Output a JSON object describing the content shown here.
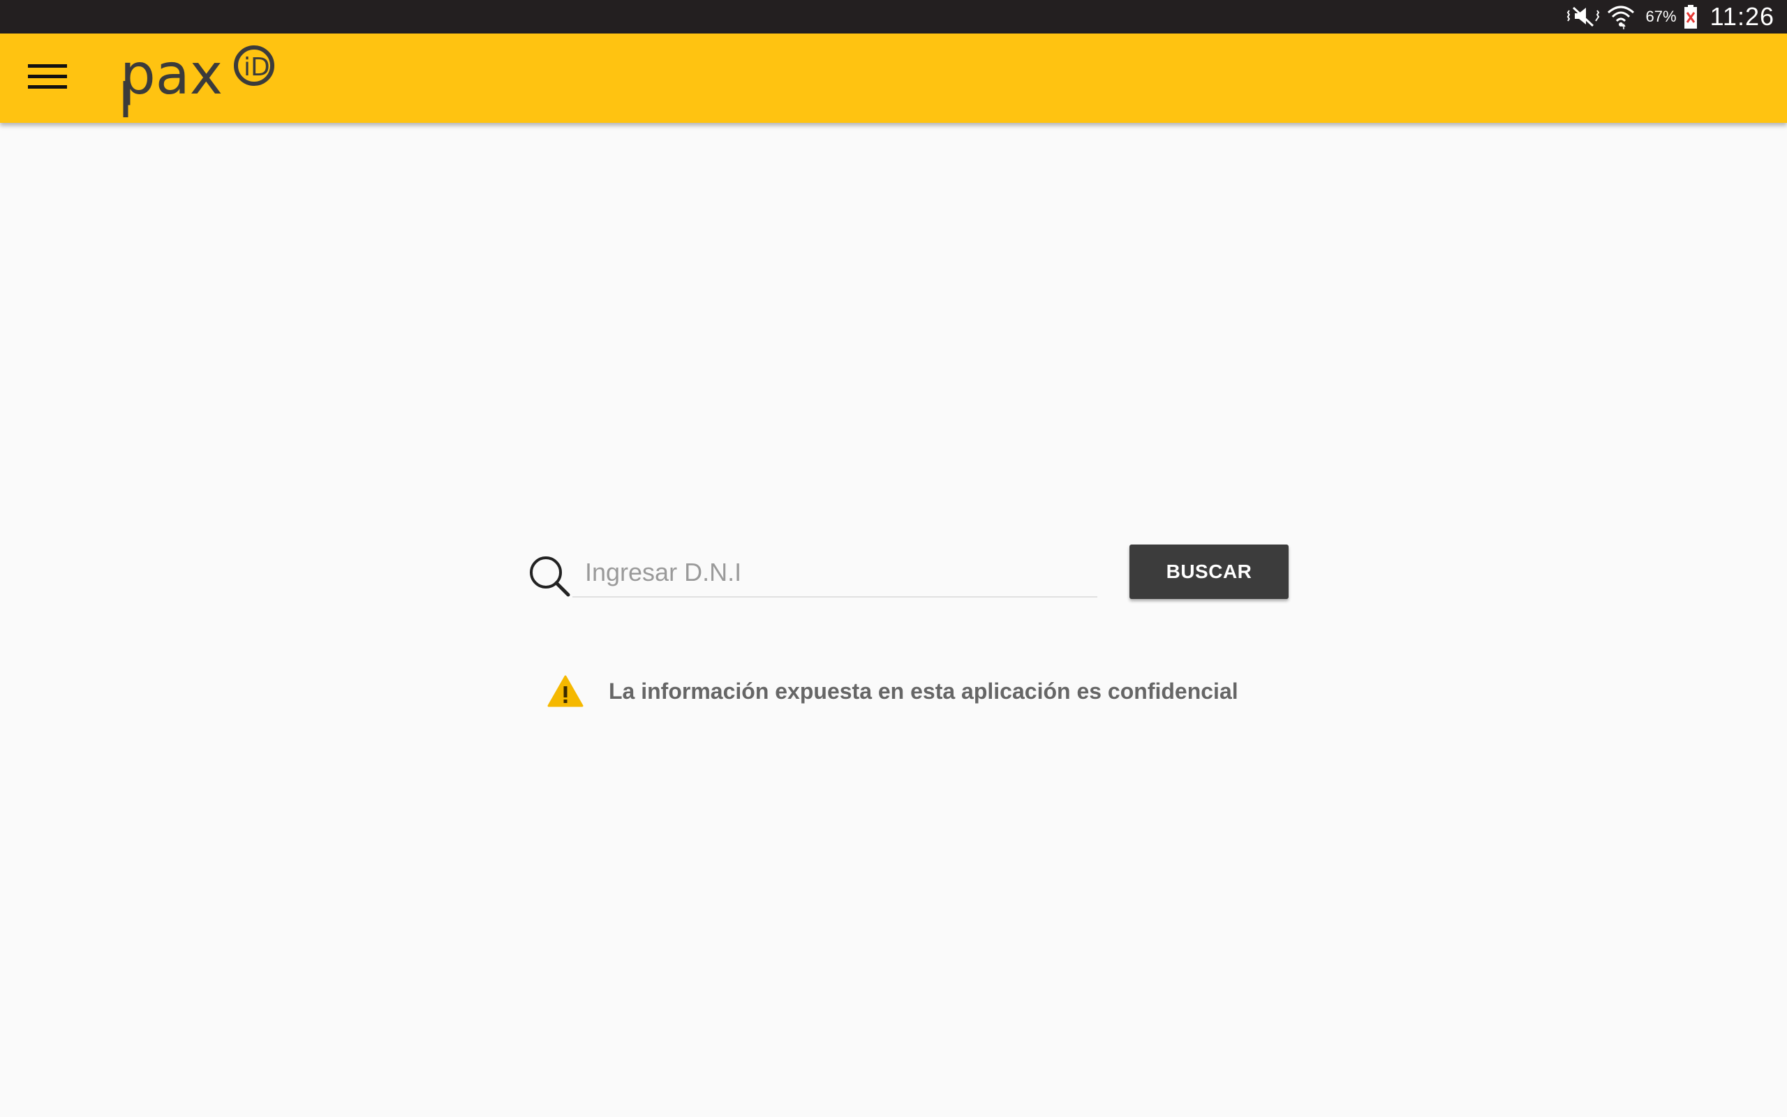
{
  "status_bar": {
    "battery_percent": "67%",
    "time": "11:26",
    "icons": [
      "vibrate-mute-icon",
      "wifi-icon",
      "battery-icon"
    ]
  },
  "app_bar": {
    "background_color": "#ffc311",
    "menu_icon": "hamburger-menu-icon",
    "logo_text": "pax",
    "logo_badge": "iD"
  },
  "search": {
    "placeholder": "Ingresar D.N.I",
    "value": "",
    "icon": "search-icon",
    "button_label": "BUSCAR"
  },
  "notice": {
    "icon": "warning-icon",
    "text": "La información expuesta en esta aplicación es confidencial",
    "icon_color": "#f5b800"
  }
}
